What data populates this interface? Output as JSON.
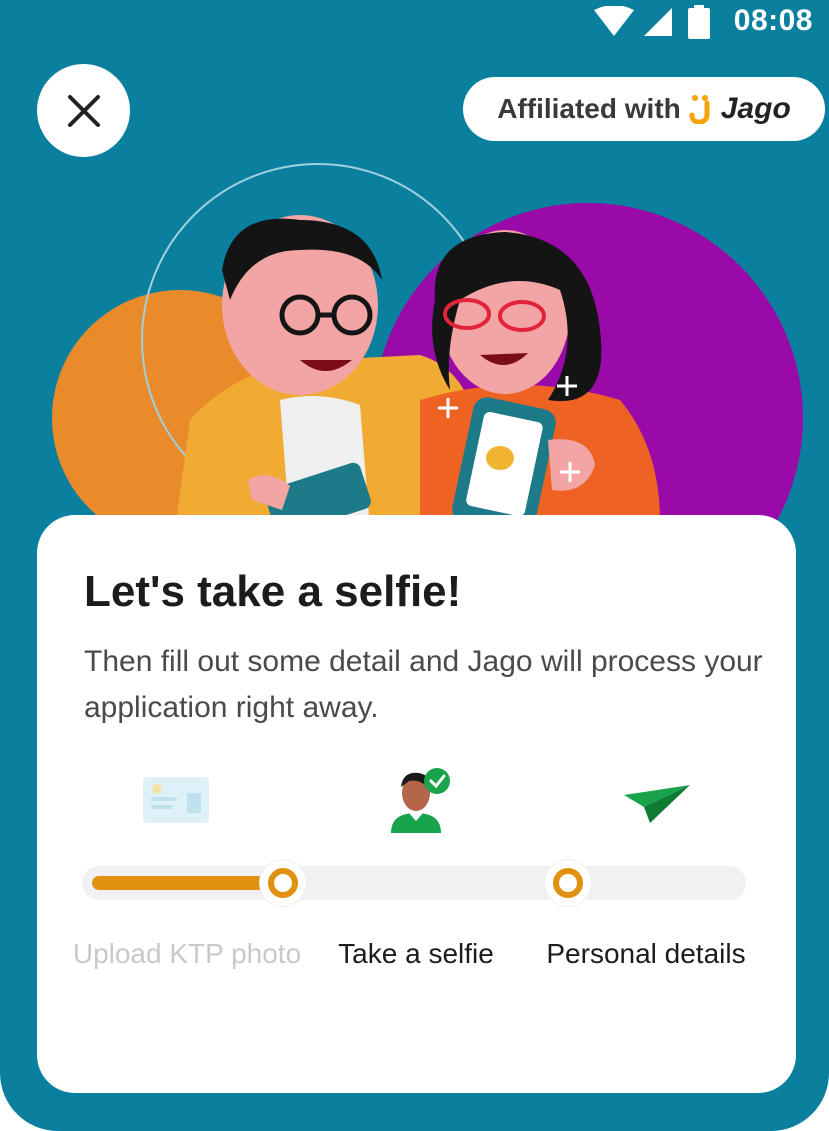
{
  "status_bar": {
    "time": "08:08"
  },
  "header": {
    "affiliated_text": "Affiliated with",
    "brand_name": "Jago"
  },
  "card": {
    "title": "Let's take a selfie!",
    "description": "Then fill out some detail and Jago will process your application right away."
  },
  "steps": [
    {
      "label": "Upload KTP photo",
      "state": "completed"
    },
    {
      "label": "Take a selfie",
      "state": "current"
    },
    {
      "label": "Personal details",
      "state": "upcoming"
    }
  ],
  "progress": {
    "completed_fraction": 0.3
  },
  "colors": {
    "background": "#0a7f9e",
    "accent": "#e1900f",
    "card": "#ffffff",
    "check": "#19a34a"
  },
  "icons": {
    "close": "close-icon",
    "id_card": "id-card-icon",
    "selfie": "selfie-check-icon",
    "paper_plane": "paper-plane-icon"
  }
}
